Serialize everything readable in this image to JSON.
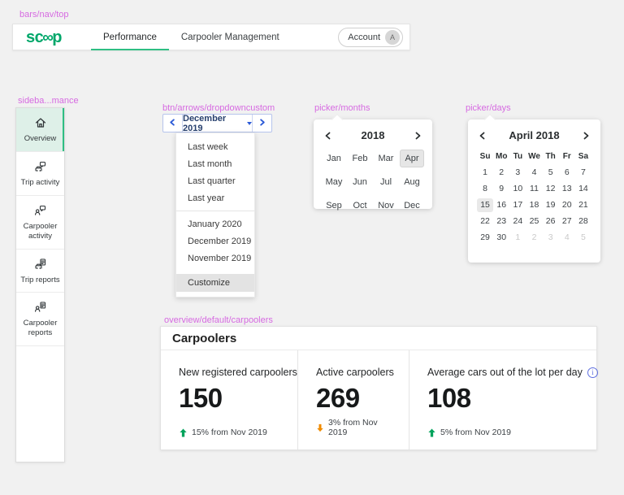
{
  "labels": {
    "top_nav": "bars/nav/top",
    "sidebar": "sideba...mance",
    "dropdown": "btn/arrows/dropdowncustom",
    "picker_months": "picker/months",
    "picker_days": "picker/days",
    "carpoolers": "overview/default/carpoolers"
  },
  "colors": {
    "brand_green": "#00a76a",
    "active_green": "#2fbe83",
    "mint_bg": "#def0e8",
    "label_magenta": "#d66ae1",
    "dropdown_blue": "#2d5bd7",
    "dropdown_navy": "#27406e",
    "trend_up": "#00a35c",
    "trend_down": "#f08b00",
    "info_blue": "#5f6fdf"
  },
  "top_nav": {
    "logo": {
      "full": "scoop",
      "prefix": "sc",
      "infinity": "∞",
      "suffix": "p"
    },
    "tabs": [
      {
        "label": "Performance",
        "active": true
      },
      {
        "label": "Carpooler Management",
        "active": false
      }
    ],
    "account": {
      "label": "Account",
      "avatar_initial": "A"
    }
  },
  "sidebar": {
    "items": [
      {
        "label": "Overview",
        "icon": "home-icon",
        "active": true
      },
      {
        "label": "Trip activity",
        "icon": "trip-activity-icon",
        "active": false
      },
      {
        "label": "Carpooler activity",
        "icon": "carpooler-activity-icon",
        "active": false
      },
      {
        "label": "Trip reports",
        "icon": "trip-reports-icon",
        "active": false
      },
      {
        "label": "Carpooler reports",
        "icon": "carpooler-reports-icon",
        "active": false
      }
    ]
  },
  "dropdown": {
    "selected": "December 2019",
    "group1": [
      "Last week",
      "Last month",
      "Last quarter",
      "Last year"
    ],
    "group2": [
      "January 2020",
      "December 2019",
      "November 2019"
    ],
    "footer": "Customize"
  },
  "month_picker": {
    "year": "2018",
    "selected": "Apr",
    "months": [
      "Jan",
      "Feb",
      "Mar",
      "Apr",
      "May",
      "Jun",
      "Jul",
      "Aug",
      "Sep",
      "Oct",
      "Nov",
      "Dec"
    ]
  },
  "day_picker": {
    "title": "April 2018",
    "selected": "15",
    "weekdays": [
      "Su",
      "Mo",
      "Tu",
      "We",
      "Th",
      "Fr",
      "Sa"
    ],
    "days": [
      "1",
      "2",
      "3",
      "4",
      "5",
      "6",
      "7",
      "8",
      "9",
      "10",
      "11",
      "12",
      "13",
      "14",
      "15",
      "16",
      "17",
      "18",
      "19",
      "20",
      "21",
      "22",
      "23",
      "24",
      "25",
      "26",
      "27",
      "28",
      "29",
      "30"
    ],
    "next_month_days": [
      "1",
      "2",
      "3",
      "4",
      "5"
    ]
  },
  "carpoolers": {
    "title": "Carpoolers",
    "stats": [
      {
        "label": "New registered carpoolers",
        "value": "150",
        "direction": "up",
        "trend": "15% from Nov 2019",
        "info": false
      },
      {
        "label": "Active carpoolers",
        "value": "269",
        "direction": "down",
        "trend": "3% from Nov 2019",
        "info": false
      },
      {
        "label": "Average cars out of the lot per day",
        "value": "108",
        "direction": "up",
        "trend": "5% from Nov 2019",
        "info": true
      }
    ]
  }
}
